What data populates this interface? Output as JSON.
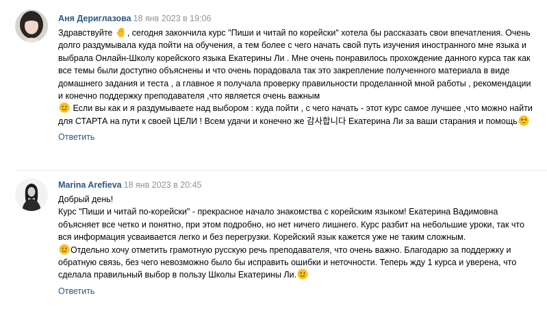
{
  "comments": [
    {
      "author": "Аня Дериглазова",
      "date": "18 янв 2023 в 19:06",
      "text_part1": "Здравствуйте",
      "text_part2": ", сегодня закончила курс \"Пиши и читай по корейски\" хотела бы рассказать свои впечатления. Очень долго раздумывала куда пойти на обучения, а тем более с чего начать свой путь изучения иностранного мне языка и выбрала Онлайн-Школу корейского языка Екатерины Ли . Мне очень понравилось прохождение данного курса так как все темы были доступно объяснены и что очень порадовала так это закрепление полученного материала в виде домашнего задания и теста , а главное я получала проверку правильности проделанной мной работы , рекомендации и конечно поддержку преподавателя ,что является очень важным",
      "text_part3": "Если вы как и я раздумываете над выбором : куда пойти , с чего начать - этот курс самое лучшее ,что можно найти для СТАРТА на пути к своей ЦЕЛИ ! Всем удачи и конечно же 감사합니다 Екатерина Ли за ваши старания и помощь",
      "reply_label": "Ответить",
      "emojis": [
        "waving-hand-icon",
        "smiling-face-icon",
        "grinning-face-icon"
      ]
    },
    {
      "author": "Marina Arefieva",
      "date": "18 янв 2023 в 20:45",
      "greeting": "Добрый день!",
      "text_part1": "Курс \"Пиши и читай по-корейски\" - прекрасное начало знакомства с корейским языком! Екатерина Вадимовна объясняет все четко и понятно, при этом подробно, но нет ничего лишнего. Курс разбит на небольшие уроки, так что вся информация усваивается легко и без перегрузки. Корейский язык кажется уже не таким сложным.",
      "text_part2": "Отдельно хочу отметить грамотную русскую речь преподавателя, что очень важно. Благодарю за поддержку и обратную связь, без чего невозможно было бы исправить ошибки и неточности. Теперь жду 1 курса и уверена, что сделала правильный выбор в пользу Школы Екатерины Ли.",
      "reply_label": "Ответить",
      "emojis": [
        "smiling-face-icon",
        "smiling-face-icon"
      ]
    }
  ],
  "colors": {
    "link": "#2a5885",
    "meta": "#939393",
    "text": "#000000",
    "divider": "#e7e8ec",
    "emoji": "#fcc21b"
  }
}
